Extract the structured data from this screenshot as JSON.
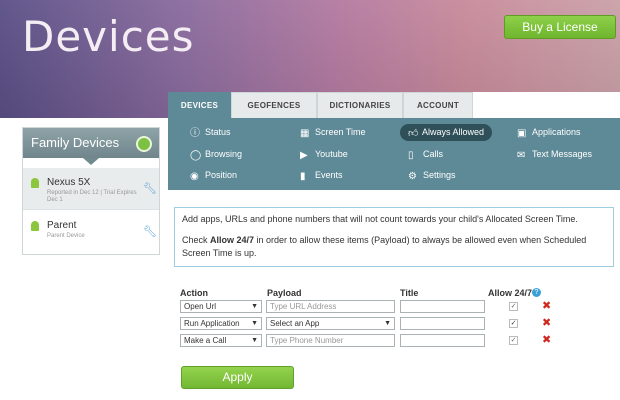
{
  "header": {
    "title": "Devices",
    "buy_label": "Buy a License"
  },
  "family": {
    "title": "Family Devices",
    "devices": [
      {
        "name": "Nexus 5X",
        "subtitle": "Reported in Dec 12 | Trial Expires Dec 1"
      },
      {
        "name": "Parent",
        "subtitle": "Parent Device"
      }
    ]
  },
  "tabs": [
    {
      "label": "DEVICES",
      "active": true
    },
    {
      "label": "GEOFENCES",
      "active": false
    },
    {
      "label": "DICTIONARIES",
      "active": false
    },
    {
      "label": "ACCOUNT",
      "active": false
    }
  ],
  "subnav": [
    {
      "label": "Status",
      "icon": "info-circle-icon"
    },
    {
      "label": "Screen Time",
      "icon": "calendar-icon"
    },
    {
      "label": "Always Allowed",
      "icon": "thumbs-up-icon",
      "active": true
    },
    {
      "label": "Applications",
      "icon": "window-icon"
    },
    {
      "label": "Browsing",
      "icon": "globe-icon"
    },
    {
      "label": "Youtube",
      "icon": "play-icon"
    },
    {
      "label": "Calls",
      "icon": "phone-icon"
    },
    {
      "label": "Text Messages",
      "icon": "envelope-icon"
    },
    {
      "label": "Position",
      "icon": "map-marker-icon"
    },
    {
      "label": "Events",
      "icon": "bar-chart-icon"
    },
    {
      "label": "Settings",
      "icon": "gear-icon"
    }
  ],
  "info": {
    "line1": "Add apps, URLs and phone numbers that will not count towards your child's Allocated Screen Time.",
    "line2_pre": "Check ",
    "line2_bold": "Allow 24/7",
    "line2_post": " in order to allow these items (Payload) to always be allowed even when Scheduled Screen Time is up."
  },
  "grid": {
    "headers": {
      "action": "Action",
      "payload": "Payload",
      "title": "Title",
      "allow": "Allow 24/7"
    },
    "rows": [
      {
        "action": "Open Url",
        "payload": "Type URL Address",
        "payload_is_placeholder": true,
        "payload_is_select": false,
        "title": "",
        "allow_checked": false
      },
      {
        "action": "Run Application",
        "payload": "Select an App",
        "payload_is_placeholder": false,
        "payload_is_select": true,
        "title": "",
        "allow_checked": true
      },
      {
        "action": "Make a Call",
        "payload": "Type Phone Number",
        "payload_is_placeholder": true,
        "payload_is_select": false,
        "title": "",
        "allow_checked": false
      }
    ]
  },
  "apply_label": "Apply"
}
